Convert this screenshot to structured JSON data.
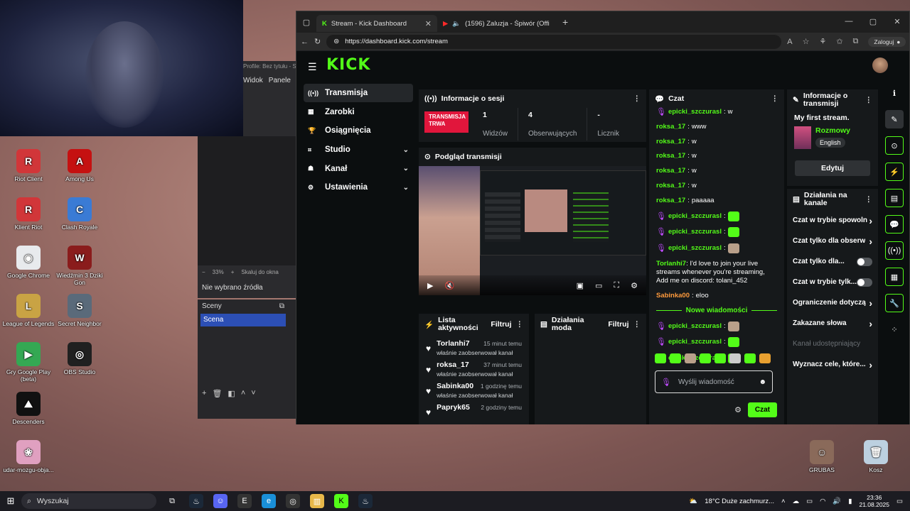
{
  "obs": {
    "profile_title": "Profile: Bez tytułu - S",
    "menu": [
      "Widok",
      "Panele"
    ],
    "zoom": "33%",
    "fit_label": "Skaluj do okna",
    "no_source": "Nie wybrano źródła",
    "scenes_title": "Sceny",
    "scene_name": "Scena"
  },
  "desktop_icons": [
    {
      "label": "Riot Client",
      "color": "#d13639",
      "glyph": "R"
    },
    {
      "label": "Among Us",
      "color": "#c51111",
      "glyph": "A"
    },
    {
      "label": "Klient Riot",
      "color": "#d13639",
      "glyph": "R"
    },
    {
      "label": "Clash Royale",
      "color": "#3a7bd5",
      "glyph": "C"
    },
    {
      "label": "Google Chrome",
      "color": "#e8eaed",
      "glyph": "◉"
    },
    {
      "label": "Wiedźmin 3 Dziki Gon",
      "color": "#8a1c1c",
      "glyph": "W"
    },
    {
      "label": "League of Legends",
      "color": "#c9a344",
      "glyph": "L"
    },
    {
      "label": "Secret Neighbor",
      "color": "#5a6a7a",
      "glyph": "S"
    },
    {
      "label": "Gry Google Play (beta)",
      "color": "#34a853",
      "glyph": "▶"
    },
    {
      "label": "OBS Studio",
      "color": "#202020",
      "glyph": "◎"
    },
    {
      "label": "Descenders",
      "color": "#111111",
      "glyph": "⛰"
    },
    {
      "label": "udar-mozgu-objа...",
      "color": "#e0a0c0",
      "glyph": "❀"
    },
    {
      "label": "GRUBAS",
      "color": "#8a6a5a",
      "glyph": "☺"
    },
    {
      "label": "Kosz",
      "color": "#bcd0e0",
      "glyph": "🗑"
    }
  ],
  "browser": {
    "tabs": [
      {
        "title": "Stream - Kick Dashboard",
        "active": true
      },
      {
        "title": "(1596) Zaluzja - Śpiwór (Offi",
        "active": false
      }
    ],
    "url": "https://dashboard.kick.com/stream",
    "signin_label": "Zaloguj"
  },
  "kick": {
    "logo": "KICK",
    "nav": [
      {
        "label": "Transmisja",
        "icon": "broadcast-icon",
        "glyph": "((•))",
        "active": true,
        "expand": false
      },
      {
        "label": "Zarobki",
        "icon": "earnings-icon",
        "glyph": "▦",
        "active": false,
        "expand": false
      },
      {
        "label": "Osiągnięcia",
        "icon": "trophy-icon",
        "glyph": "🏆",
        "active": false,
        "expand": false
      },
      {
        "label": "Studio",
        "icon": "studio-icon",
        "glyph": "⌗",
        "active": false,
        "expand": true
      },
      {
        "label": "Kanał",
        "icon": "channel-icon",
        "glyph": "☗",
        "active": false,
        "expand": true
      },
      {
        "label": "Ustawienia",
        "icon": "settings-icon",
        "glyph": "⚙",
        "active": false,
        "expand": true
      }
    ],
    "session": {
      "title": "Informacje o sesji",
      "badge": "TRANSMISJA TRWA",
      "stats": [
        {
          "value": "1",
          "label": "Widzów"
        },
        {
          "value": "4",
          "label": "Obserwujących"
        },
        {
          "value": "-",
          "label": "Licznik"
        }
      ]
    },
    "preview_title": "Podgląd transmisji",
    "activity": {
      "title": "Lista aktywności",
      "filter": "Filtruj",
      "items": [
        {
          "name": "Torlanhi7",
          "time": "15 minut temu",
          "desc": "właśnie zaobserwował kanał"
        },
        {
          "name": "roksa_17",
          "time": "37 minut temu",
          "desc": "właśnie zaobserwował kanał"
        },
        {
          "name": "Sabinka00",
          "time": "1 godzinę temu",
          "desc": "właśnie zaobserwował kanał"
        },
        {
          "name": "Papryk65",
          "time": "2 godziny temu",
          "desc": ""
        }
      ]
    },
    "mod": {
      "title": "Działania moda",
      "filter": "Filtruj"
    },
    "chat": {
      "title": "Czat",
      "messages": [
        {
          "user": "epicki_szczurasl",
          "text": "w",
          "mic": true,
          "emote": "",
          "color": "#53fc18"
        },
        {
          "user": "roksa_17",
          "text": "www",
          "mic": false,
          "emote": "",
          "color": "#53fc18"
        },
        {
          "user": "roksa_17",
          "text": "w",
          "mic": false,
          "emote": "",
          "color": "#53fc18"
        },
        {
          "user": "roksa_17",
          "text": "w",
          "mic": false,
          "emote": "",
          "color": "#53fc18"
        },
        {
          "user": "roksa_17",
          "text": "w",
          "mic": false,
          "emote": "",
          "color": "#53fc18"
        },
        {
          "user": "roksa_17",
          "text": "w",
          "mic": false,
          "emote": "",
          "color": "#53fc18"
        },
        {
          "user": "roksa_17",
          "text": "paaaaa",
          "mic": false,
          "emote": "",
          "color": "#53fc18"
        },
        {
          "user": "epicki_szczurasl",
          "text": "",
          "mic": true,
          "emote": "green",
          "color": "#53fc18"
        },
        {
          "user": "epicki_szczurasl",
          "text": "",
          "mic": true,
          "emote": "green",
          "color": "#53fc18"
        },
        {
          "user": "epicki_szczurasl",
          "text": "",
          "mic": true,
          "emote": "cat",
          "color": "#53fc18"
        }
      ],
      "long_message": {
        "user": "Torlanhi7",
        "text": "I'd love to join your live streams whenever you're streaming, Add me on discord: tolani_452",
        "color": "#53fc18"
      },
      "sabinka": {
        "user": "Sabinka00",
        "text": "eloo",
        "color": "#ff9a3c"
      },
      "new_messages_label": "Nowe wiadomości",
      "after_new": [
        {
          "user": "epicki_szczurasl",
          "emote": "cat"
        },
        {
          "user": "epicki_szczurasl",
          "emote": "green"
        },
        {
          "user": "epicki_szczurasl",
          "emote": "green"
        }
      ],
      "input_placeholder": "Wyślij wiadomość",
      "send_label": "Czat"
    },
    "stream_info": {
      "title": "Informacje o transmisji",
      "stream_title": "My first stream.",
      "category": "Rozmowy",
      "language": "English",
      "edit_label": "Edytuj"
    },
    "quick_actions": {
      "title": "Działania na kanale",
      "items": [
        {
          "label": "Czat w trybie spowoln",
          "type": "chevron",
          "dim": false
        },
        {
          "label": "Czat tylko dla obserw",
          "type": "chevron",
          "dim": false
        },
        {
          "label": "Czat tylko dla...",
          "type": "toggle",
          "dim": false
        },
        {
          "label": "Czat w trybie tylk...",
          "type": "toggle",
          "dim": false
        },
        {
          "label": "Ograniczenie dotyczą",
          "type": "chevron",
          "dim": false
        },
        {
          "label": "Zakazane słowa",
          "type": "chevron",
          "dim": false
        },
        {
          "label": "Kanał udostępniający",
          "type": "none",
          "dim": true
        },
        {
          "label": "Wyznacz cele, które...",
          "type": "chevron",
          "dim": false
        }
      ]
    }
  },
  "taskbar": {
    "search": "Wyszukaj",
    "weather": "18°C  Duże zachmurz...",
    "time": "23:36",
    "date": "21.08.2025"
  }
}
